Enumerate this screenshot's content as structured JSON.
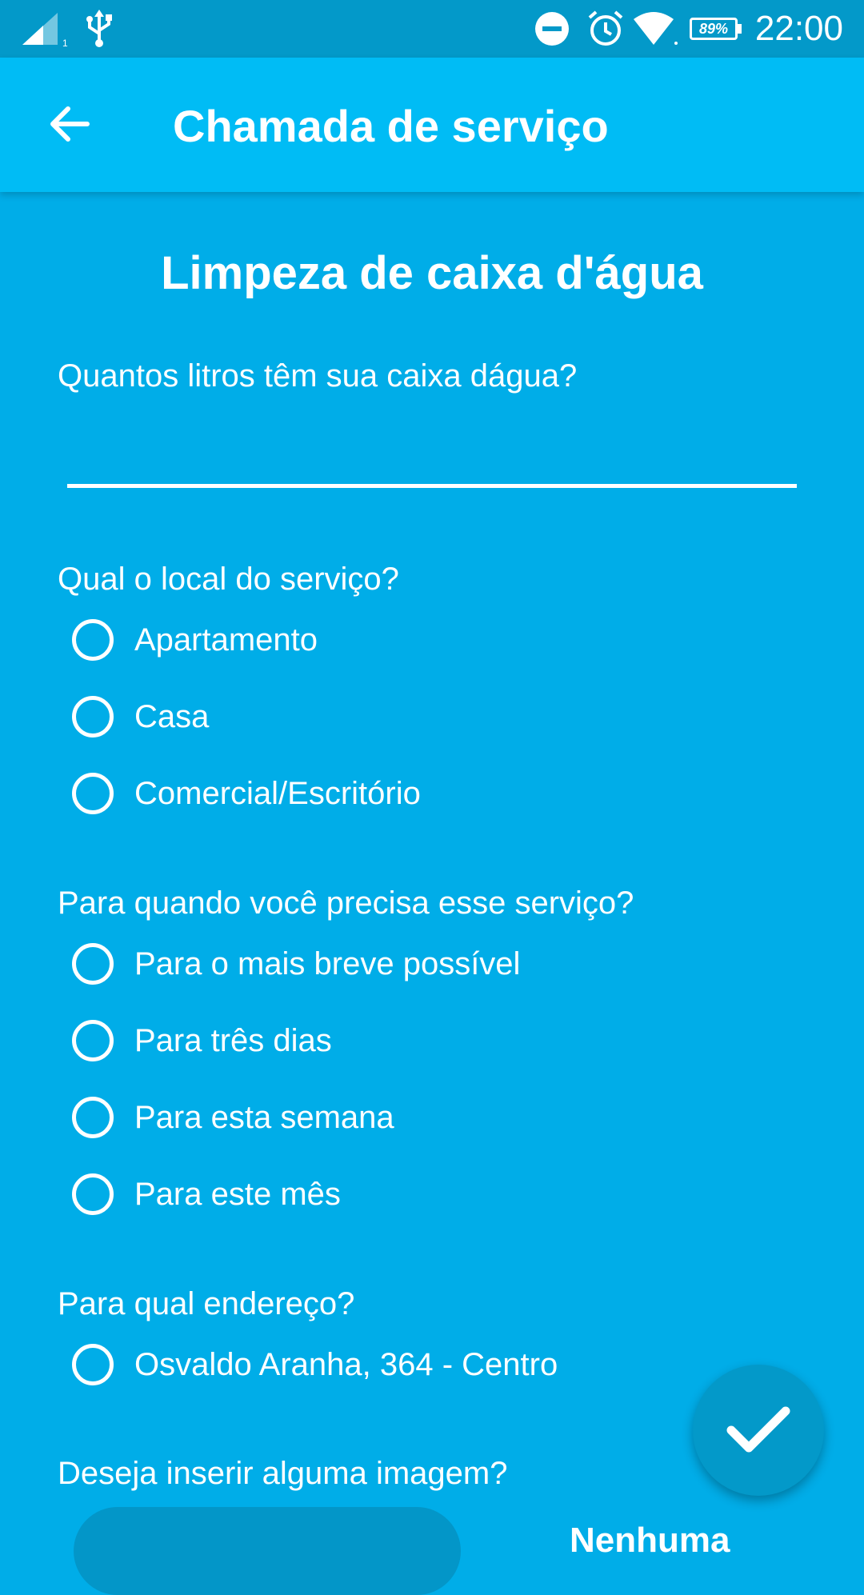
{
  "status_bar": {
    "battery": "89%",
    "time": "22:00",
    "icons": [
      "signal-icon",
      "usb-icon",
      "do-not-disturb-icon",
      "alarm-icon",
      "wifi-icon",
      "battery-icon"
    ]
  },
  "app_bar": {
    "title": "Chamada de serviço",
    "back_icon": "arrow-left-icon"
  },
  "form": {
    "title": "Limpeza de caixa d'água",
    "q_liters": {
      "label": "Quantos litros têm sua caixa dágua?",
      "value": ""
    },
    "q_location": {
      "label": "Qual o local do serviço?",
      "options": [
        "Apartamento",
        "Casa",
        "Comercial/Escritório"
      ]
    },
    "q_when": {
      "label": "Para quando você precisa esse serviço?",
      "options": [
        "Para o mais breve possível",
        "Para três dias",
        "Para esta semana",
        "Para este mês"
      ]
    },
    "q_address": {
      "label": "Para qual endereço?",
      "options": [
        "Osvaldo Aranha, 364 - Centro"
      ]
    },
    "q_image": {
      "label": "Deseja inserir alguma imagem?",
      "side_text": "Nenhuma"
    }
  },
  "fab": {
    "icon": "check-icon"
  },
  "colors": {
    "background": "#00ADE8",
    "app_bar": "#00BCF5",
    "status_bar": "#0399C9",
    "fab": "#0399C9"
  }
}
